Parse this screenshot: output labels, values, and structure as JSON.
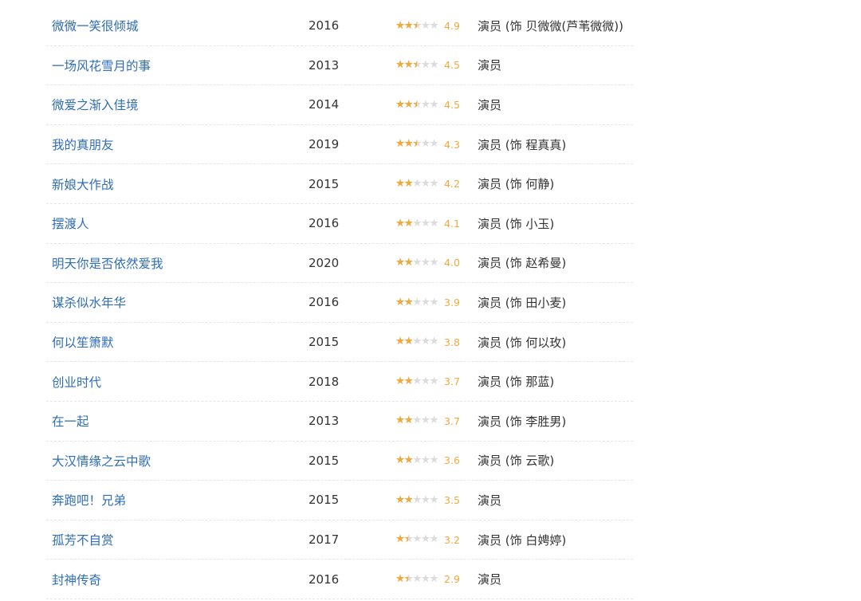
{
  "colors": {
    "link": "#2f6db5",
    "star_on": "#f2a93b",
    "star_off": "#dcdcdc",
    "text": "#333333"
  },
  "icons": {
    "rating": "star-icon"
  },
  "films": [
    {
      "title": "微微一笑很倾城",
      "year": "2016",
      "rating": "4.9",
      "stars": 2.5,
      "role": "演员 (饰 贝微微(芦苇微微))"
    },
    {
      "title": "一场风花雪月的事",
      "year": "2013",
      "rating": "4.5",
      "stars": 2.5,
      "role": "演员"
    },
    {
      "title": "微爱之渐入佳境",
      "year": "2014",
      "rating": "4.5",
      "stars": 2.5,
      "role": "演员"
    },
    {
      "title": "我的真朋友",
      "year": "2019",
      "rating": "4.3",
      "stars": 2.5,
      "role": "演员 (饰 程真真)"
    },
    {
      "title": "新娘大作战",
      "year": "2015",
      "rating": "4.2",
      "stars": 2,
      "role": "演员 (饰 何静)"
    },
    {
      "title": "摆渡人",
      "year": "2016",
      "rating": "4.1",
      "stars": 2,
      "role": "演员 (饰 小玉)"
    },
    {
      "title": "明天你是否依然爱我",
      "year": "2020",
      "rating": "4.0",
      "stars": 2,
      "role": "演员 (饰 赵希曼)"
    },
    {
      "title": "谋杀似水年华",
      "year": "2016",
      "rating": "3.9",
      "stars": 2,
      "role": "演员 (饰 田小麦)"
    },
    {
      "title": "何以笙箫默",
      "year": "2015",
      "rating": "3.8",
      "stars": 2,
      "role": "演员 (饰 何以玫)"
    },
    {
      "title": "创业时代",
      "year": "2018",
      "rating": "3.7",
      "stars": 2,
      "role": "演员 (饰 那蓝)"
    },
    {
      "title": "在一起",
      "year": "2013",
      "rating": "3.7",
      "stars": 2,
      "role": "演员 (饰 李胜男)"
    },
    {
      "title": "大汉情缘之云中歌",
      "year": "2015",
      "rating": "3.6",
      "stars": 2,
      "role": "演员 (饰 云歌)"
    },
    {
      "title": "奔跑吧！兄弟",
      "year": "2015",
      "rating": "3.5",
      "stars": 2,
      "role": "演员"
    },
    {
      "title": "孤芳不自赏",
      "year": "2017",
      "rating": "3.2",
      "stars": 1.5,
      "role": "演员 (饰 白娉婷)"
    },
    {
      "title": "封神传奇",
      "year": "2016",
      "rating": "2.9",
      "stars": 1.5,
      "role": "演员"
    }
  ]
}
